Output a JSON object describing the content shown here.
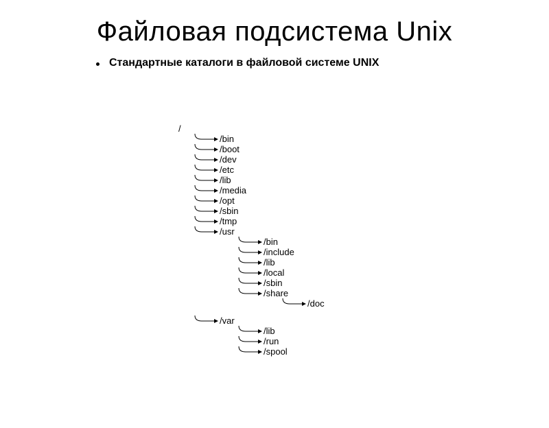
{
  "title": "Файловая подсистема Unix",
  "subtitle": "Стандартные каталоги в файловой системе UNIX",
  "tree": {
    "root": "/",
    "children": [
      {
        "label": "/bin"
      },
      {
        "label": "/boot"
      },
      {
        "label": "/dev"
      },
      {
        "label": "/etc"
      },
      {
        "label": "/lib"
      },
      {
        "label": "/media"
      },
      {
        "label": "/opt"
      },
      {
        "label": "/sbin"
      },
      {
        "label": "/tmp"
      },
      {
        "label": "/usr",
        "children": [
          {
            "label": "/bin"
          },
          {
            "label": "/include"
          },
          {
            "label": "/lib"
          },
          {
            "label": "/local"
          },
          {
            "label": "/sbin"
          },
          {
            "label": "/share",
            "children": [
              {
                "label": "/doc"
              }
            ]
          }
        ]
      },
      {
        "label": "/var",
        "children": [
          {
            "label": "/lib"
          },
          {
            "label": "/run"
          },
          {
            "label": "/spool"
          }
        ]
      }
    ]
  }
}
